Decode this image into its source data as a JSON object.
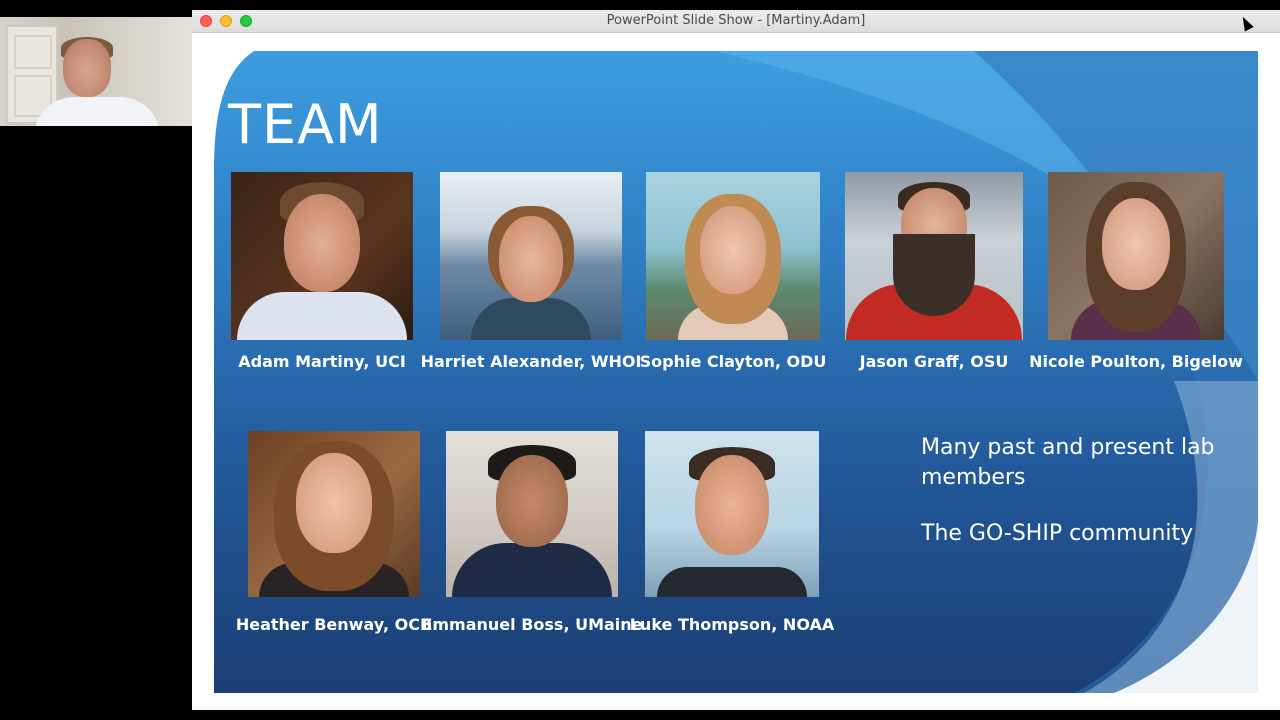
{
  "window": {
    "title": "PowerPoint Slide Show - [Martiny.Adam]"
  },
  "slide": {
    "title": "TEAM",
    "members": [
      {
        "name": "Adam Martiny, UCI"
      },
      {
        "name": "Harriet Alexander, WHOI"
      },
      {
        "name": "Sophie Clayton, ODU"
      },
      {
        "name": "Jason Graff, OSU"
      },
      {
        "name": "Nicole Poulton, Bigelow"
      },
      {
        "name": "Heather Benway, OCB"
      },
      {
        "name": "Emmanuel Boss, UMaine"
      },
      {
        "name": "Luke Thompson, NOAA"
      }
    ],
    "notes": [
      "Many past and present lab members",
      "The GO-SHIP community"
    ]
  },
  "icons": {
    "close": "close-icon",
    "minimize": "minimize-icon",
    "maximize": "maximize-icon",
    "cursor": "mouse-cursor-icon"
  }
}
